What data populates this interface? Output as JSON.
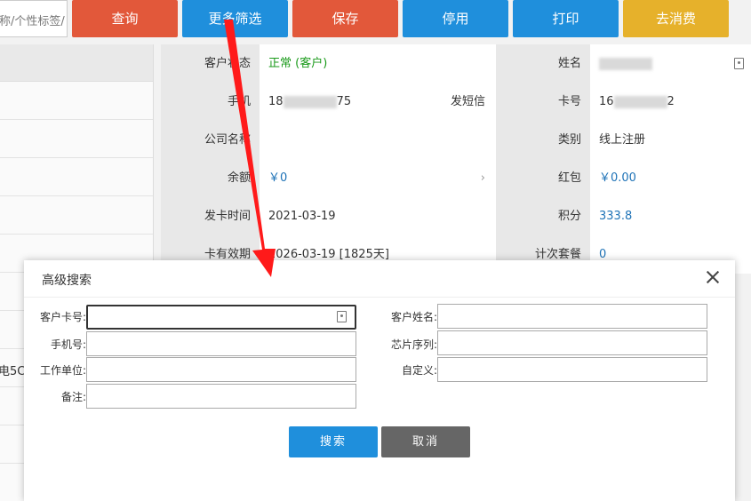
{
  "toolbar": {
    "search_placeholder": "称/个性标签/",
    "query": "查询",
    "more_filter": "更多筛选",
    "save": "保存",
    "disable": "停用",
    "print": "打印",
    "consume": "去消费"
  },
  "left": {
    "partial_text": "电5C"
  },
  "info": {
    "status_label": "客户状态",
    "status_value": "正常 (客户)",
    "name_label": "姓名",
    "phone_label": "手机",
    "phone_prefix": "18",
    "phone_suffix": "75",
    "sms": "发短信",
    "card_label": "卡号",
    "card_prefix": "16",
    "card_suffix": "2",
    "company_label": "公司名称",
    "category_label": "类别",
    "category_value": "线上注册",
    "balance_label": "余额",
    "balance_value": "￥0",
    "redpack_label": "红包",
    "redpack_value": "￥0.00",
    "issue_label": "发卡时间",
    "issue_value": "2021-03-19",
    "points_label": "积分",
    "points_value": "333.8",
    "valid_label": "卡有效期",
    "valid_value": "2026-03-19 [1825天]",
    "package_label": "计次套餐",
    "package_value": "0"
  },
  "modal": {
    "title": "高级搜索",
    "card_no_label": "客户卡号:",
    "name_label": "客户姓名:",
    "phone_label": "手机号:",
    "chip_label": "芯片序列:",
    "work_label": "工作单位:",
    "custom_label": "自定义:",
    "remark_label": "备注:",
    "search_btn": "搜索",
    "cancel_btn": "取消"
  },
  "colors": {
    "red_btn": "#e2583a",
    "blue_btn": "#1f8fdc",
    "yellow_btn": "#e6b12b",
    "arrow": "#ff1a1a"
  }
}
